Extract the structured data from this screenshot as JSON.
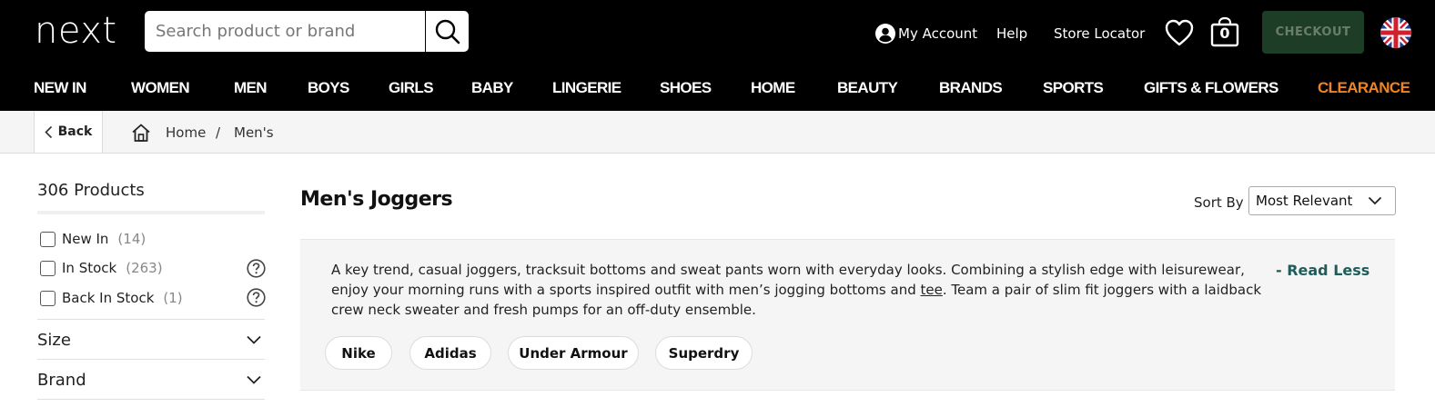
{
  "header": {
    "logo": "next",
    "search": {
      "placeholder": "Search product or brand",
      "value": ""
    },
    "links": {
      "my_account": "My Account",
      "help": "Help",
      "store_locator": "Store Locator"
    },
    "bag_count": "0",
    "checkout_label": "CHECKOUT",
    "colors": {
      "background": "#000000",
      "checkout": "#1e3d26",
      "clearance": "#f08424"
    }
  },
  "nav": {
    "items": [
      "NEW IN",
      "WOMEN",
      "MEN",
      "BOYS",
      "GIRLS",
      "BABY",
      "LINGERIE",
      "SHOES",
      "HOME",
      "BEAUTY",
      "BRANDS",
      "SPORTS",
      "GIFTS & FLOWERS",
      "CLEARANCE"
    ]
  },
  "breadcrumb": {
    "back_label": "Back",
    "home": "Home",
    "separator": "/",
    "current": "Men's"
  },
  "filters": {
    "products_count": "306 Products",
    "checkboxes": [
      {
        "label": "New In",
        "count": "(14)",
        "has_help": false
      },
      {
        "label": "In Stock",
        "count": "(263)",
        "has_help": true
      },
      {
        "label": "Back In Stock",
        "count": "(1)",
        "has_help": true
      }
    ],
    "facets": [
      "Size",
      "Brand"
    ]
  },
  "main": {
    "title": "Men's Joggers",
    "sort_label": "Sort By",
    "sort_value": "Most Relevant",
    "description_part1": "A key trend, casual joggers, tracksuit bottoms and sweat pants worn with everyday looks. Combining a stylish edge with leisurewear, enjoy your morning runs with a sports inspired outfit with men’s jogging bottoms and ",
    "description_link": "tee",
    "description_part2": ". Team a pair of slim fit joggers with a laidback crew neck sweater and fresh pumps for an off-duty ensemble.",
    "read_less": "- Read Less",
    "brand_chips": [
      "Nike",
      "Adidas",
      "Under Armour",
      "Superdry"
    ]
  },
  "icons": {
    "search": "search-icon",
    "account": "account-icon",
    "wishlist": "heart-icon",
    "bag": "bag-icon",
    "flag": "uk-flag-icon",
    "back": "chevron-left-icon",
    "home": "home-icon",
    "help": "help-icon",
    "chevron": "chevron-down-icon"
  }
}
